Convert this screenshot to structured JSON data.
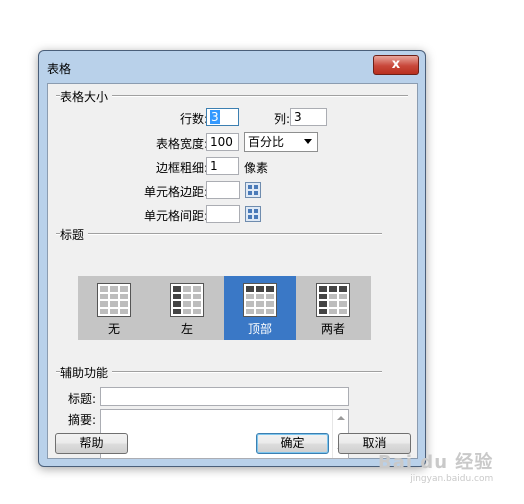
{
  "window": {
    "title": "表格",
    "close_glyph": "x"
  },
  "table_size": {
    "section_label": "表格大小",
    "rows": {
      "label": "行数:",
      "value": "3"
    },
    "cols": {
      "label": "列:",
      "value": "3"
    },
    "width": {
      "label": "表格宽度:",
      "value": "100",
      "unit": "百分比"
    },
    "border": {
      "label": "边框粗细:",
      "value": "1",
      "unit": "像素"
    },
    "cell_padding": {
      "label": "单元格边距:",
      "value": ""
    },
    "cell_spacing": {
      "label": "单元格间距:",
      "value": ""
    }
  },
  "header": {
    "section_label": "标题",
    "options": [
      {
        "label": "无",
        "icon": "table-no-header-icon",
        "selected": false
      },
      {
        "label": "左",
        "icon": "table-left-header-icon",
        "selected": false
      },
      {
        "label": "顶部",
        "icon": "table-top-header-icon",
        "selected": true
      },
      {
        "label": "两者",
        "icon": "table-both-header-icon",
        "selected": false
      }
    ]
  },
  "accessibility": {
    "section_label": "辅助功能",
    "caption": {
      "label": "标题:",
      "value": ""
    },
    "summary": {
      "label": "摘要:",
      "value": ""
    }
  },
  "buttons": {
    "help": "帮助",
    "ok": "确定",
    "cancel": "取消"
  },
  "watermark": {
    "text": "Bai du 经验",
    "sub": "jingyan.baidu.com"
  },
  "colors": {
    "selected_option": "#3a78c6",
    "window_frame": "#b9d1ea"
  }
}
